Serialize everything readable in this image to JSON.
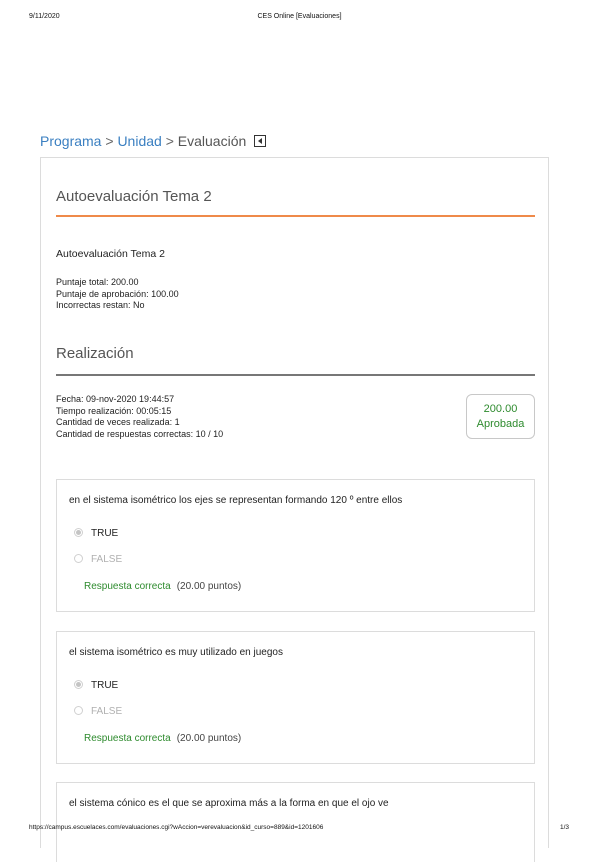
{
  "print_header": {
    "date": "9/11/2020",
    "title": "CES Online [Evaluaciones]"
  },
  "breadcrumb": {
    "items": [
      "Programa",
      "Unidad"
    ],
    "separator": ">",
    "current": "Evaluación"
  },
  "card": {
    "title": "Autoevaluación Tema 2",
    "eval_name": "Autoevaluación Tema 2",
    "info": [
      "Puntaje total: 200.00",
      "Puntaje de aprobación: 100.00",
      "Incorrectas restan: No"
    ],
    "section_title": "Realización",
    "attempt": [
      "Fecha: 09-nov-2020 19:44:57",
      "Tiempo realización: 00:05:15",
      "Cantidad de veces realizada: 1",
      "Cantidad de respuestas correctas: 10 / 10"
    ],
    "score": {
      "value": "200.00",
      "status": "Aprobada"
    }
  },
  "questions": [
    {
      "text": "en el sistema isométrico los ejes se representan formando 120 º entre ellos",
      "options": [
        {
          "label": "TRUE",
          "selected": true
        },
        {
          "label": "FALSE",
          "selected": false
        }
      ],
      "result": "Respuesta correcta",
      "points": "(20.00 puntos)"
    },
    {
      "text": "el sistema isométrico es muy utilizado en juegos",
      "options": [
        {
          "label": "TRUE",
          "selected": true
        },
        {
          "label": "FALSE",
          "selected": false
        }
      ],
      "result": "Respuesta correcta",
      "points": "(20.00 puntos)"
    },
    {
      "text": "el sistema cónico es el que se aproxima más a la forma en que el ojo ve"
    }
  ],
  "print_footer": {
    "url": "https://campus.escuelaces.com/evaluaciones.cgi?wAccion=verevaluacion&id_curso=889&id=1201606",
    "page": "1/3"
  },
  "colors": {
    "link": "#3a7fc1",
    "accent_rule": "#ef8a4a",
    "success": "#2e8b2e"
  }
}
